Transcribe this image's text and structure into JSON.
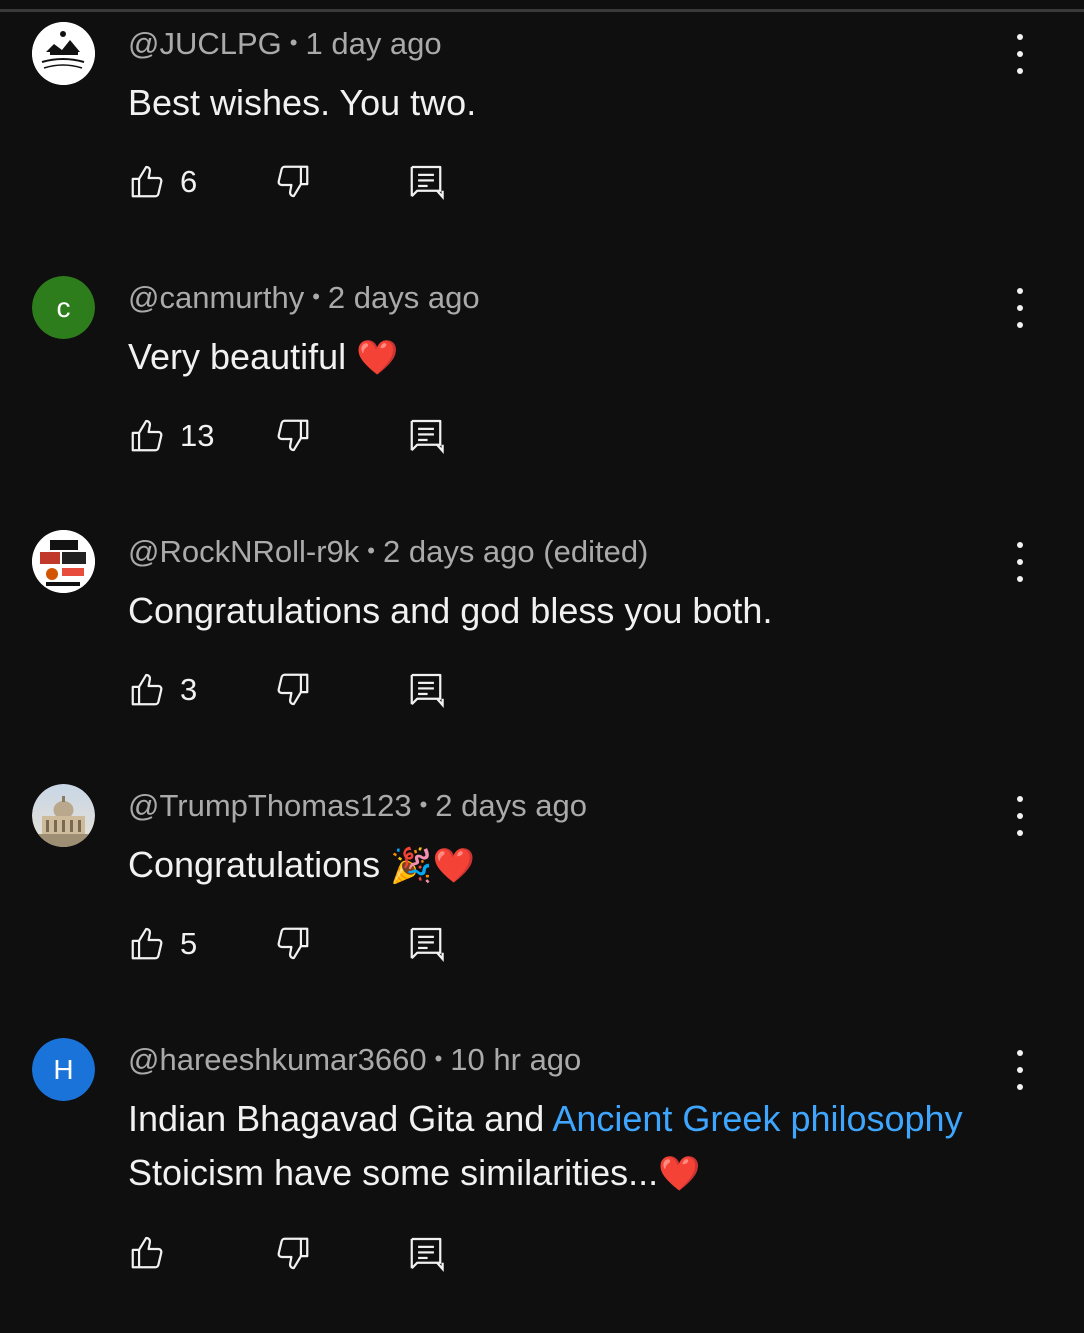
{
  "comments": [
    {
      "author": "@JUCLPG",
      "time": "1 day ago",
      "text": "Best wishes. You two.",
      "likes": "6",
      "avatar": {
        "type": "image",
        "desc": "comparative literature logo",
        "color": "#ffffff"
      }
    },
    {
      "author": "@canmurthy",
      "time": "2 days ago",
      "text": "Very beautiful",
      "emoji": "❤️",
      "likes": "13",
      "avatar": {
        "type": "letter",
        "letter": "c",
        "color": "#2e7d1c"
      }
    },
    {
      "author": "@RockNRoll-r9k",
      "time": "2 days ago (edited)",
      "text": "Congratulations and god bless you both.",
      "likes": "3",
      "avatar": {
        "type": "image",
        "desc": "rock band logos collage",
        "color": "#ffffff"
      }
    },
    {
      "author": "@TrumpThomas123",
      "time": "2 days ago",
      "text": "Congratulations",
      "emoji": "🎉❤️",
      "likes": "5",
      "avatar": {
        "type": "image",
        "desc": "basilica photo",
        "color": "#c9b89a"
      }
    },
    {
      "author": "@hareeshkumar3660",
      "time": "10 hr ago",
      "text_before": "Indian Bhagavad Gita and ",
      "text_link": "Ancient Greek philosophy",
      "text_after": "Stoicism have some similarities...",
      "emoji": "❤️",
      "likes": "",
      "avatar": {
        "type": "letter",
        "letter": "H",
        "color": "#1a73d9"
      }
    }
  ],
  "colors": {
    "background": "#0f0f0f",
    "text": "#f1f1f1",
    "meta": "#aaaaaa",
    "link": "#3ea6ff"
  },
  "icons": [
    "thumbs-up-icon",
    "thumbs-down-icon",
    "reply-icon",
    "more-vert-icon"
  ]
}
